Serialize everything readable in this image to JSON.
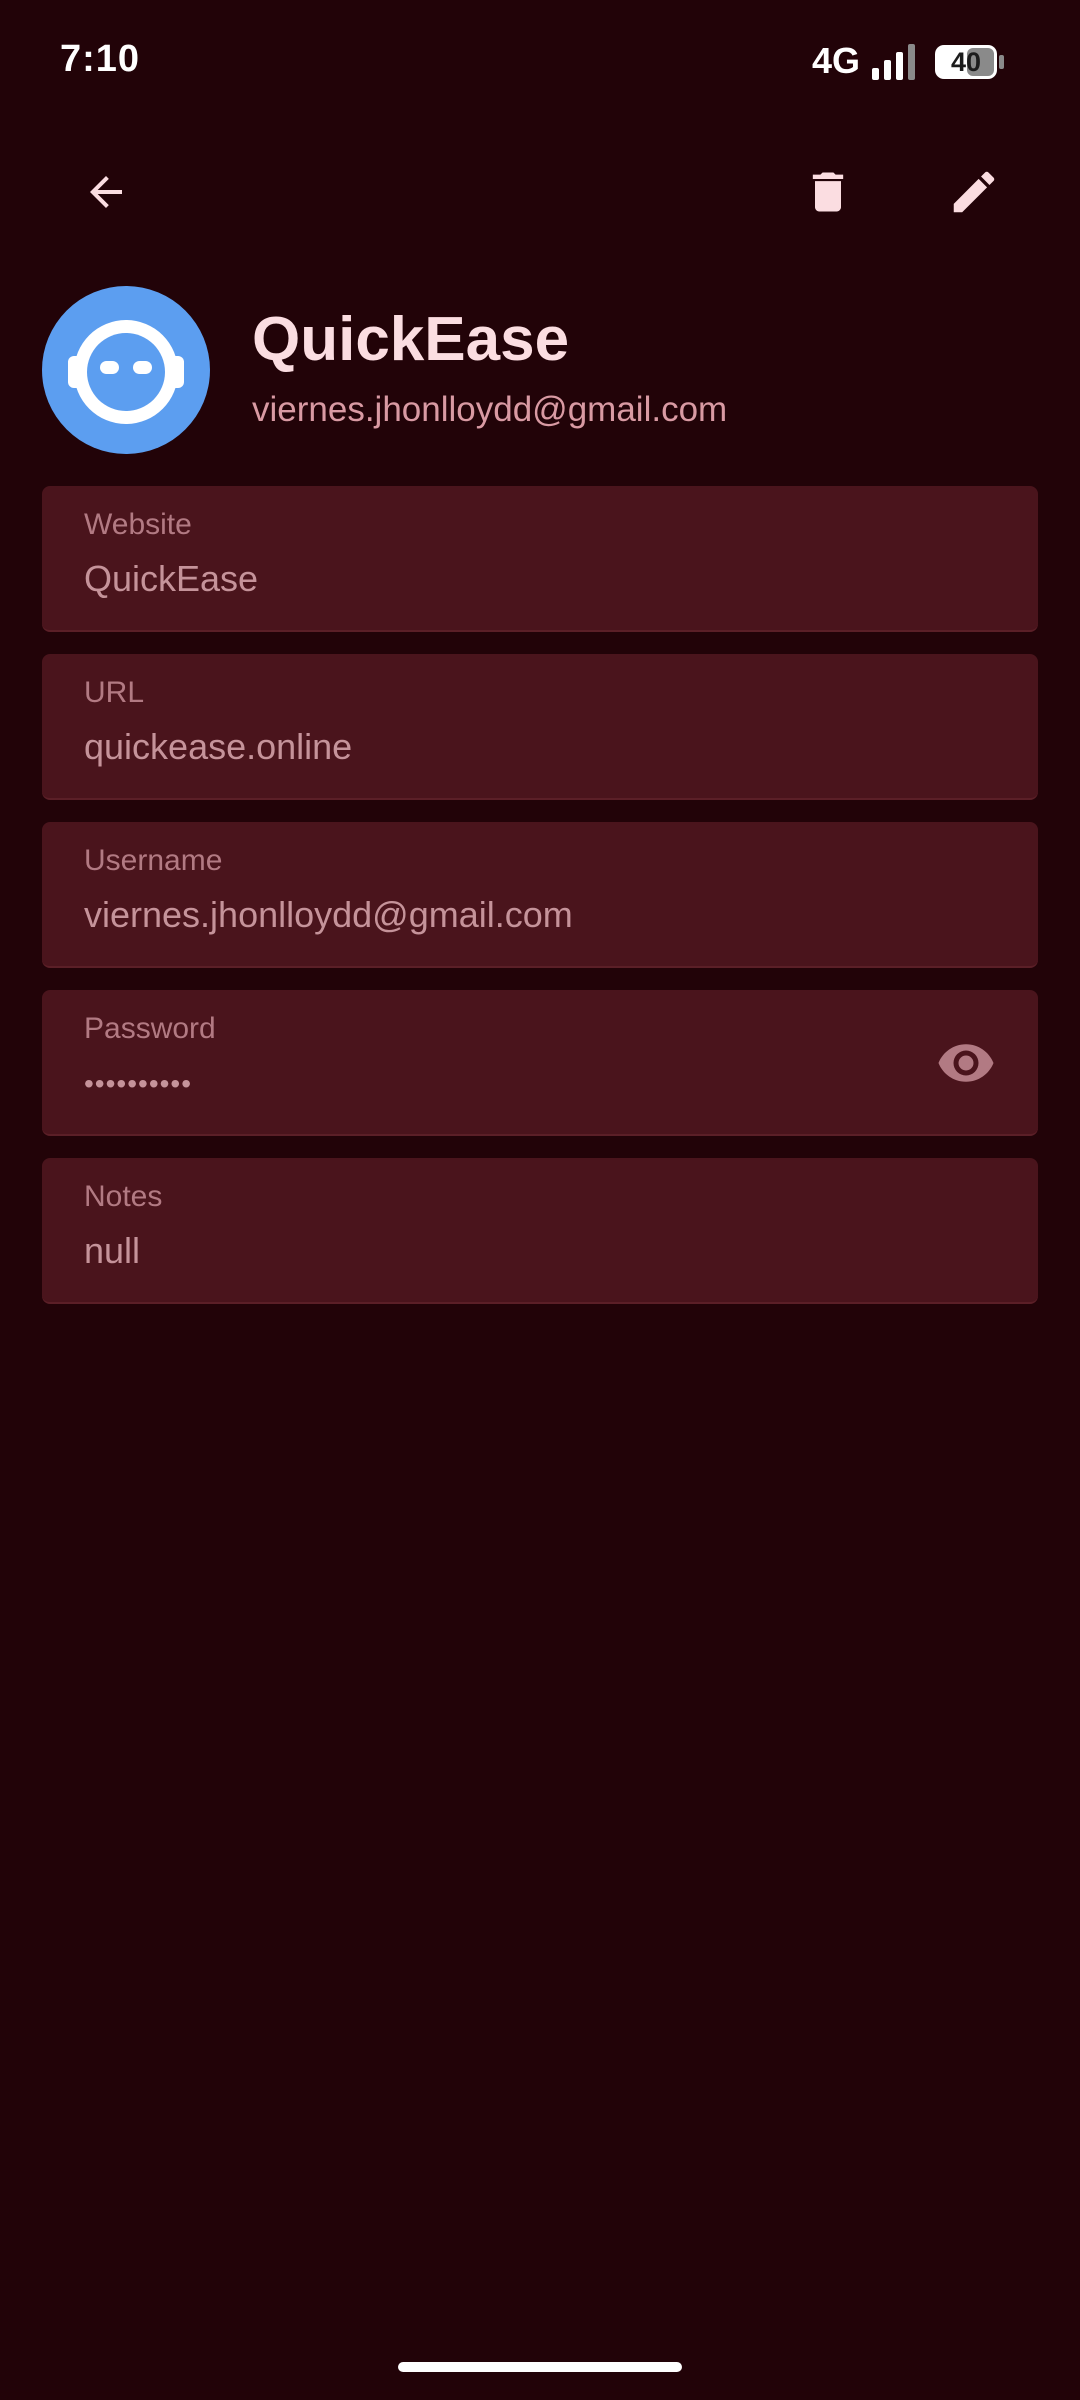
{
  "status_bar": {
    "time": "7:10",
    "network": "4G",
    "battery": "40"
  },
  "app_bar": {
    "back_icon": "arrow-back-icon",
    "delete_icon": "trash-icon",
    "edit_icon": "pencil-icon"
  },
  "header": {
    "avatar_icon": "robot-face-icon",
    "title": "QuickEase",
    "subtitle": "viernes.jhonlloydd@gmail.com"
  },
  "fields": {
    "website": {
      "label": "Website",
      "value": "QuickEase"
    },
    "url": {
      "label": "URL",
      "value": "quickease.online"
    },
    "username": {
      "label": "Username",
      "value": "viernes.jhonlloydd@gmail.com"
    },
    "password": {
      "label": "Password",
      "value": "••••••••••",
      "toggle_icon": "eye-icon"
    },
    "notes": {
      "label": "Notes",
      "value": "null"
    }
  },
  "colors": {
    "background": "#220308",
    "field_background": "#4a141c",
    "avatar": "#5c9ef0",
    "title": "#fbdde1",
    "subtitle": "#d99aa3",
    "label": "#b27a83",
    "value": "#c5939a"
  }
}
